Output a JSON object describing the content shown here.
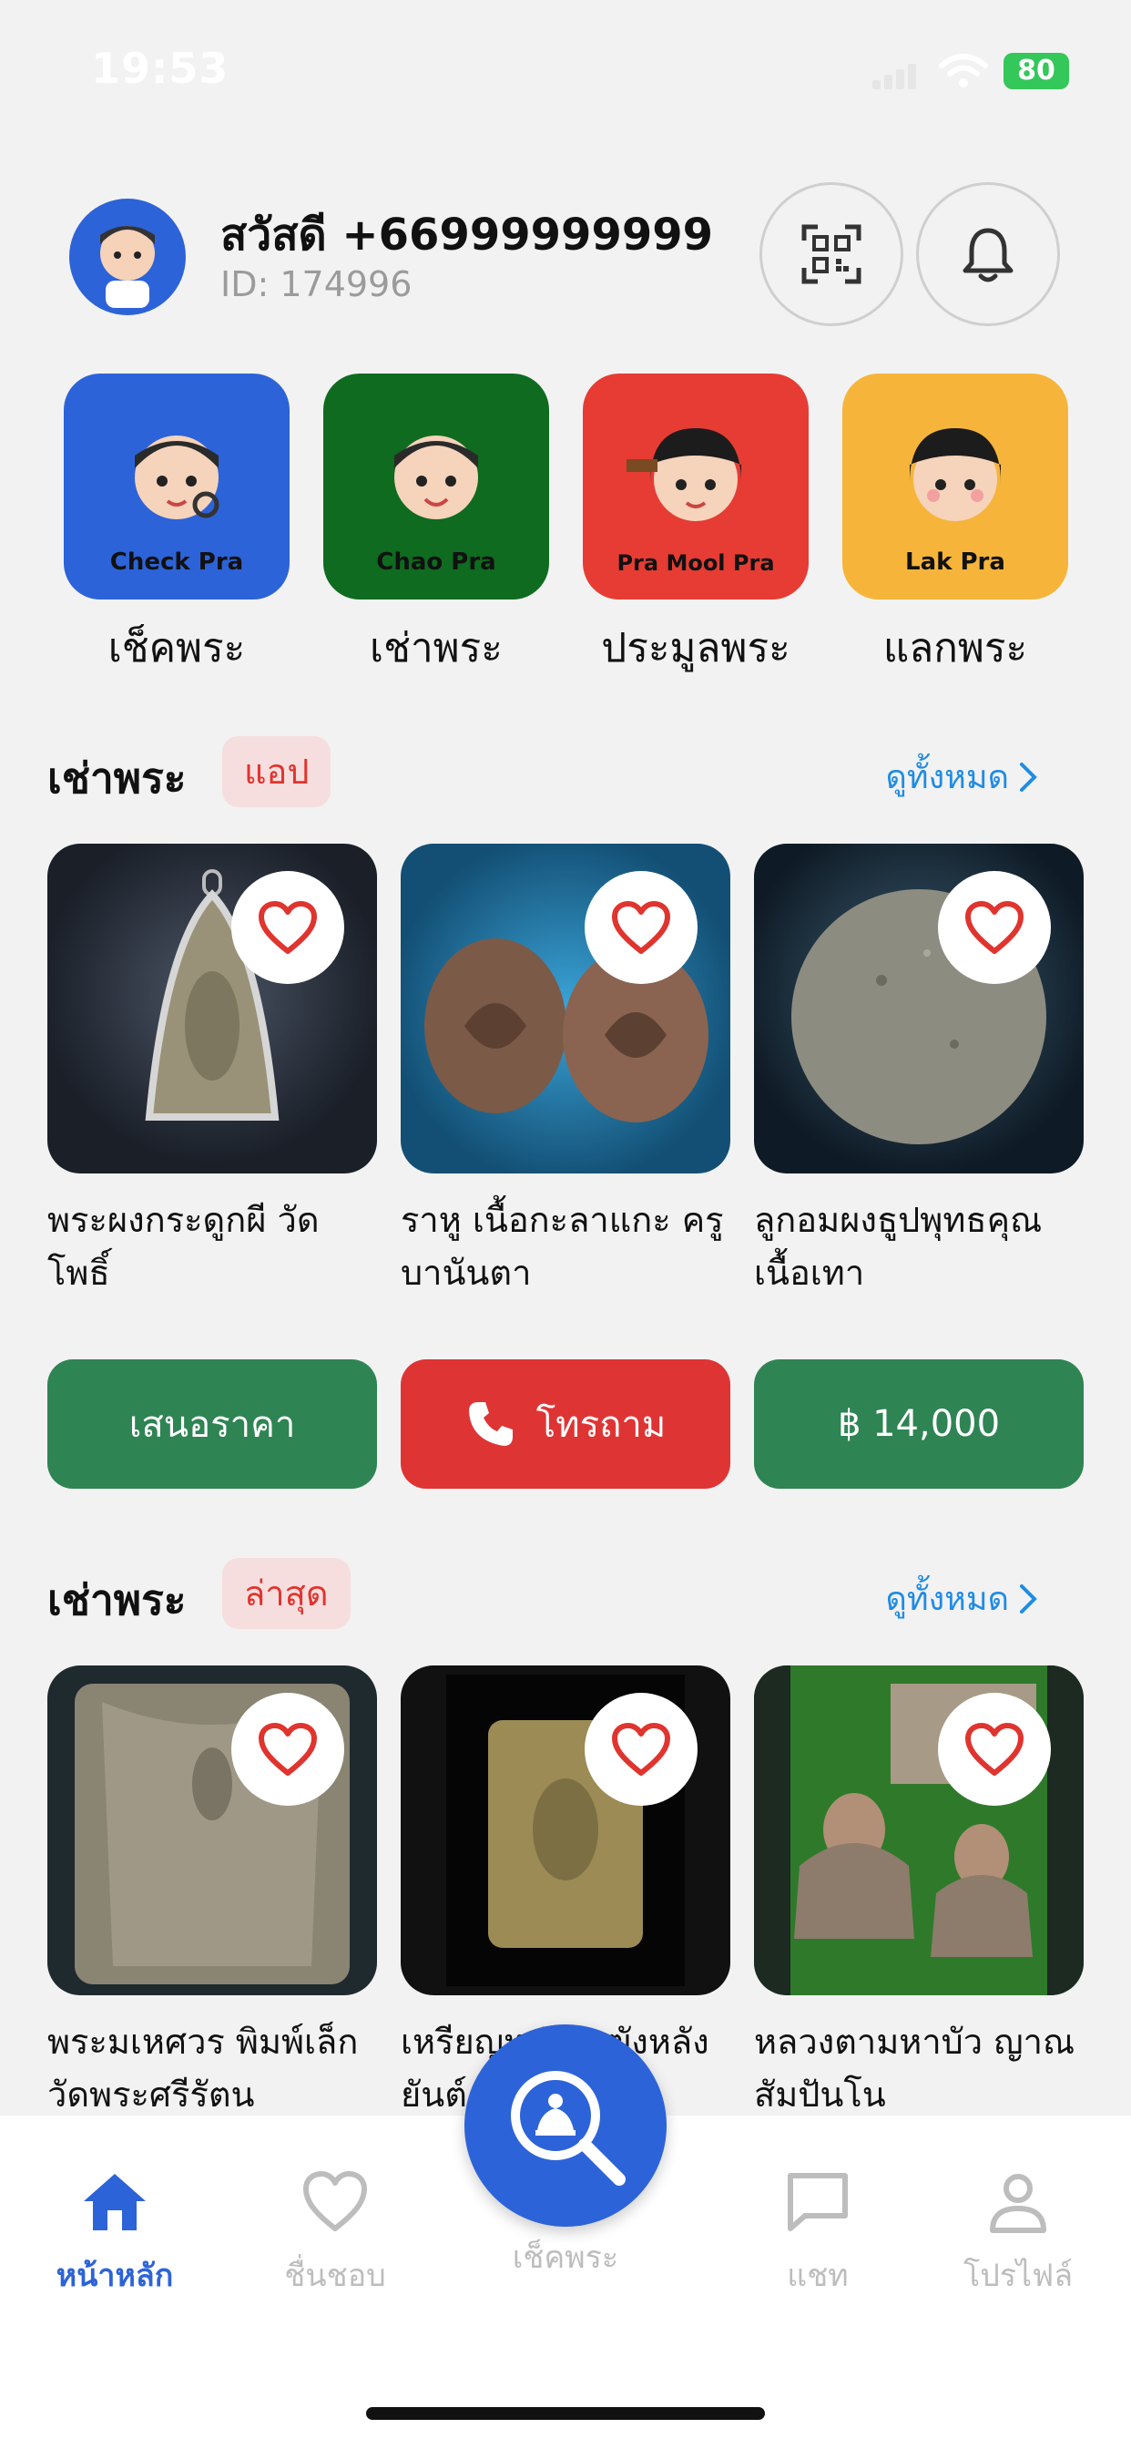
{
  "status_bar": {
    "time": "19:53",
    "battery": "80"
  },
  "header": {
    "greeting": "สวัสดี +66999999999",
    "user_id": "ID: 174996"
  },
  "categories": [
    {
      "label": "เช็คพระ",
      "badge": "Check Pra",
      "color": "#2d63d8"
    },
    {
      "label": "เช่าพระ",
      "badge": "Chao Pra",
      "color": "#0f6b1f"
    },
    {
      "label": "ประมูลพระ",
      "badge": "Pra Mool Pra",
      "color": "#e63c34"
    },
    {
      "label": "แลกพระ",
      "badge": "Lak Pra",
      "color": "#f6b53a"
    }
  ],
  "section1": {
    "title": "เช่าพระ",
    "tag": "แอป",
    "see_all": "ดูทั้งหมด",
    "items": [
      {
        "title": "พระผงกระดูกผี วัดโพธิ์"
      },
      {
        "title": "ราหู เนื้อกะลาแกะ ครูบานันตา"
      },
      {
        "title": "ลูกอมผงธูปพุทธคุณ เนื้อเทา"
      }
    ]
  },
  "actions": {
    "offer": "เสนอราคา",
    "call": "โทรถาม",
    "price": "฿ 14,000"
  },
  "section2": {
    "title": "เช่าพระ",
    "tag": "ล่าสุด",
    "see_all": "ดูทั้งหมด",
    "items": [
      {
        "title": "พระมเหศวร พิมพ์เล็ก วัดพระศรีรัตน"
      },
      {
        "title": "เหรียญหล่อระฆังหลังยันต์ ครูบาอัง"
      },
      {
        "title": "หลวงตามหาบัว ญาณสัมปันโน"
      }
    ]
  },
  "nav": {
    "home": "หน้าหลัก",
    "favorites": "ชื่นชอบ",
    "check": "เช็คพระ",
    "chat": "แชท",
    "profile": "โปรไฟล์"
  },
  "colors": {
    "primary": "#2d63d8",
    "green": "#2f8453",
    "red": "#df3434",
    "link": "#1f8ce5"
  }
}
